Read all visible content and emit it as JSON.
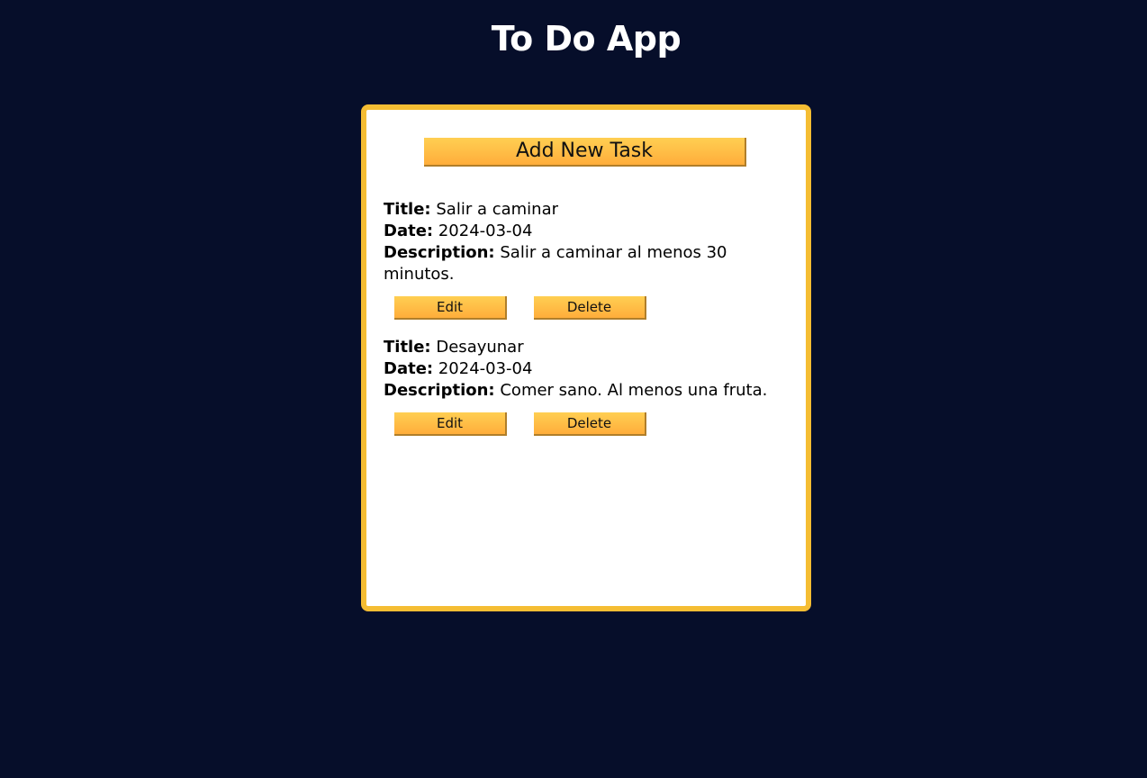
{
  "app": {
    "title": "To Do App"
  },
  "card": {
    "add_button_label": "Add New Task"
  },
  "labels": {
    "title": "Title:",
    "date": "Date:",
    "description": "Description:",
    "edit": "Edit",
    "delete": "Delete"
  },
  "tasks": [
    {
      "title": "Salir a caminar",
      "date": "2024-03-04",
      "description": "Salir a caminar al menos 30 minutos."
    },
    {
      "title": "Desayunar",
      "date": "2024-03-04",
      "description": "Comer sano. Al menos una fruta."
    }
  ],
  "colors": {
    "background": "#060e2a",
    "card_border": "#f5bd33",
    "button_top": "#ffcf52",
    "button_bottom": "#ffad3b"
  }
}
